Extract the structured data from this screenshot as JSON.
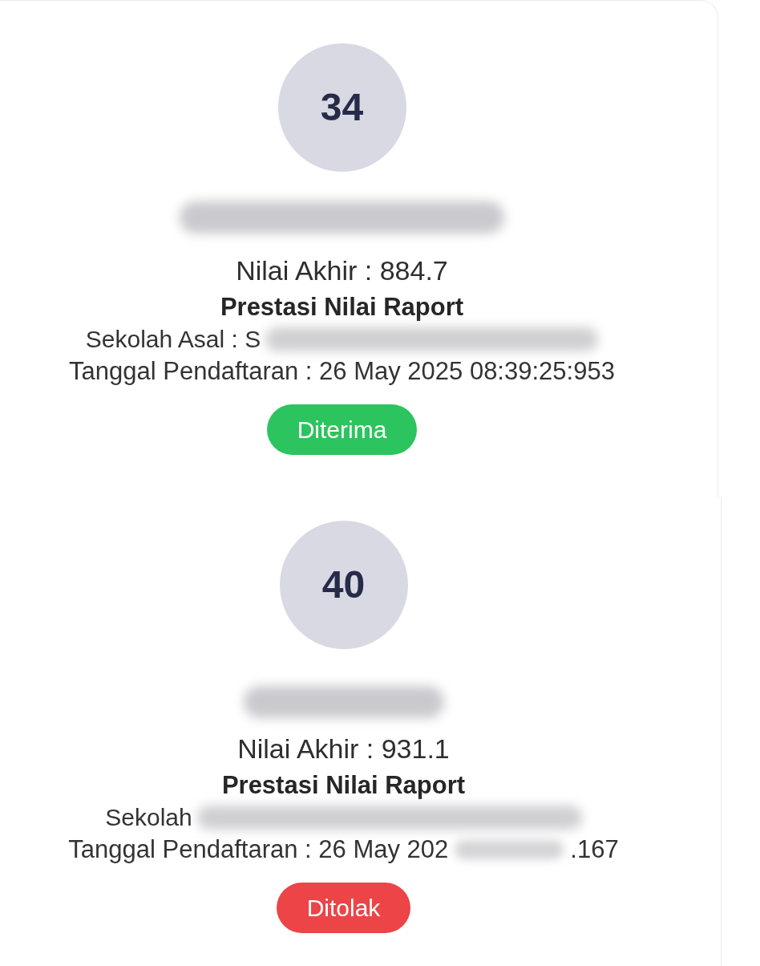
{
  "cards": [
    {
      "rank": "34",
      "score": "Nilai Akhir : 884.7",
      "track": "Prestasi Nilai Raport",
      "school": "Sekolah Asal : S",
      "date": "Tanggal Pendaftaran : 26 May 2025 08:39:25:953",
      "status": {
        "label": "Diterima",
        "kind": "accepted"
      }
    },
    {
      "rank": "40",
      "score": "Nilai Akhir : 931.1",
      "track": "Prestasi Nilai Raport",
      "school": "Sekolah",
      "date": "Tanggal Pendaftaran : 26 May 202",
      "date_tail": ".167",
      "status": {
        "label": "Ditolak",
        "kind": "rejected"
      }
    }
  ]
}
